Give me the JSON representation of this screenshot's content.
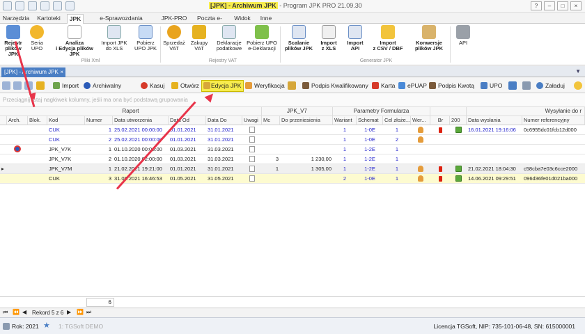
{
  "window": {
    "title_highlight": "[JPK] - Archiwum JPK",
    "title_rest": "- Program JPK PRO 21.09.30"
  },
  "menu_tabs": [
    {
      "label": "Narzędzia"
    },
    {
      "label": "Kartoteki"
    },
    {
      "label": "JPK"
    },
    {
      "label": "e-Sprawozdania Finansowe"
    },
    {
      "label": "JPK-PRO"
    },
    {
      "label": "Poczta e-Mail"
    },
    {
      "label": "Widok"
    },
    {
      "label": "Inne"
    }
  ],
  "ribbon": {
    "buttons": [
      {
        "label": "Rejestr\nplików JPK"
      },
      {
        "label": "Seria\nUPO"
      },
      {
        "label": "Analiza\ni Edycja plików JPK"
      },
      {
        "label": "Import JPK\ndo XLS"
      },
      {
        "label": "Pobierz\nUPO JPK"
      },
      {
        "label": "Sprzedaż\nVAT"
      },
      {
        "label": "Zakupy\nVAT"
      },
      {
        "label": "Deklaracje\npodatkowe"
      },
      {
        "label": "Pobierz UPO\ne-Deklaracji"
      },
      {
        "label": "Scalanie\nplików JPK"
      },
      {
        "label": "Import\nz XLS"
      },
      {
        "label": "Import\nAPI"
      },
      {
        "label": "Import\nz CSV / DBF"
      },
      {
        "label": "Konwersje\nplików JPK"
      },
      {
        "label": "API"
      }
    ],
    "groups": [
      {
        "label": "Pliki Xml"
      },
      {
        "label": "Rejestry VAT"
      },
      {
        "label": "Generator JPK"
      }
    ]
  },
  "doc_tab": {
    "label": "[JPK] - Archiwum JPK"
  },
  "toolbar": {
    "import": "Import",
    "archiwalny": "Archiwalny",
    "kasuj": "Kasuj",
    "otworz": "Otwórz",
    "edycja": "Edycja JPK",
    "weryfikacja": "Weryfikacja",
    "podpis_kwal": "Podpis Kwalifikowany",
    "karta": "Karta",
    "epuap": "ePUAP",
    "podpis_kwota": "Podpis Kwotą",
    "upo": "UPO",
    "zaladuj": "Załaduj"
  },
  "group_hint": "Przeciągnij tutaj nagłówek kolumny, jeśli ma ona być podstawą grupowania",
  "grid": {
    "band_headers": {
      "raport": "Raport",
      "jpk_v7": "JPK_V7",
      "parametry": "Parametry Formularza",
      "wyslanie": "Wysyłanie do r"
    },
    "columns": [
      "Arch.",
      "Blok.",
      "Kod",
      "Numer",
      "Data utworzenia",
      "Data Od",
      "Data Do",
      "Uwagi",
      "Mc",
      "Do przeniesienia",
      "Wariant",
      "Schemat",
      "Cel złoże...",
      "Wer...",
      "Br",
      "200",
      "Data wysłania",
      "Numer referencyjny"
    ],
    "rows": [
      {
        "kod": "CUK",
        "numer": "1",
        "utw": "25.02.2021 00:00:00",
        "od": "01.01.2021",
        "do": "31.01.2021",
        "mc": "",
        "przen": "",
        "wariant": "1",
        "schemat": "1-0E",
        "cel": "1",
        "wer": true,
        "br": true,
        "ok": true,
        "wysl": "16.01.2021 19:16:06",
        "ref": "0c6955dc01fcb12d000",
        "blue": true,
        "arch": false
      },
      {
        "kod": "CUK",
        "numer": "2",
        "utw": "25.02.2021 00:00:00",
        "od": "01.01.2021",
        "do": "31.01.2021",
        "mc": "",
        "przen": "",
        "wariant": "1",
        "schemat": "1-0E",
        "cel": "2",
        "wer": true,
        "br": false,
        "ok": false,
        "wysl": "",
        "ref": "",
        "blue": true,
        "arch": false
      },
      {
        "kod": "JPK_V7K",
        "numer": "1",
        "utw": "01.10.2020 00:00:00",
        "od": "01.03.2021",
        "do": "31.03.2021",
        "mc": "",
        "przen": "",
        "wariant": "1",
        "schemat": "1-2E",
        "cel": "1",
        "wer": false,
        "br": false,
        "ok": false,
        "wysl": "",
        "ref": "",
        "blue": false,
        "arch": true
      },
      {
        "kod": "JPK_V7K",
        "numer": "2",
        "utw": "01.10.2020 02:00:00",
        "od": "01.03.2021",
        "do": "31.03.2021",
        "mc": "3",
        "przen": "1 230,00",
        "wariant": "1",
        "schemat": "1-2E",
        "cel": "1",
        "wer": false,
        "br": false,
        "ok": false,
        "wysl": "",
        "ref": "",
        "blue": false,
        "arch": false
      },
      {
        "kod": "JPK_V7M",
        "numer": "1",
        "utw": "21.02.2021 19:21:00",
        "od": "01.01.2021",
        "do": "31.01.2021",
        "mc": "1",
        "przen": "1 305,00",
        "wariant": "1",
        "schemat": "1-2E",
        "cel": "1",
        "wer": true,
        "br": true,
        "ok": true,
        "wysl": "21.02.2021 18:04:30",
        "ref": "c58cba7e03c6cce2000",
        "blue": false,
        "arch": false
      },
      {
        "kod": "CUK",
        "numer": "3",
        "utw": "31.05.2021 16:46:53",
        "od": "01.05.2021",
        "do": "31.05.2021",
        "mc": "",
        "przen": "",
        "wariant": "2",
        "schemat": "1-0E",
        "cel": "1",
        "wer": true,
        "br": true,
        "ok": true,
        "wysl": "14.06.2021 09:29:51",
        "ref": "096d36fe01d021ba000",
        "blue": false,
        "arch": false
      }
    ]
  },
  "footer": {
    "count": "6"
  },
  "nav": {
    "record": "Rekord 5 z 6"
  },
  "status": {
    "rok": "Rok: 2021",
    "firma": "1: TGSoft DEMO",
    "licencja": "Licencja TGSoft,  NIP: 735-101-06-48,  SN: 615000001"
  }
}
